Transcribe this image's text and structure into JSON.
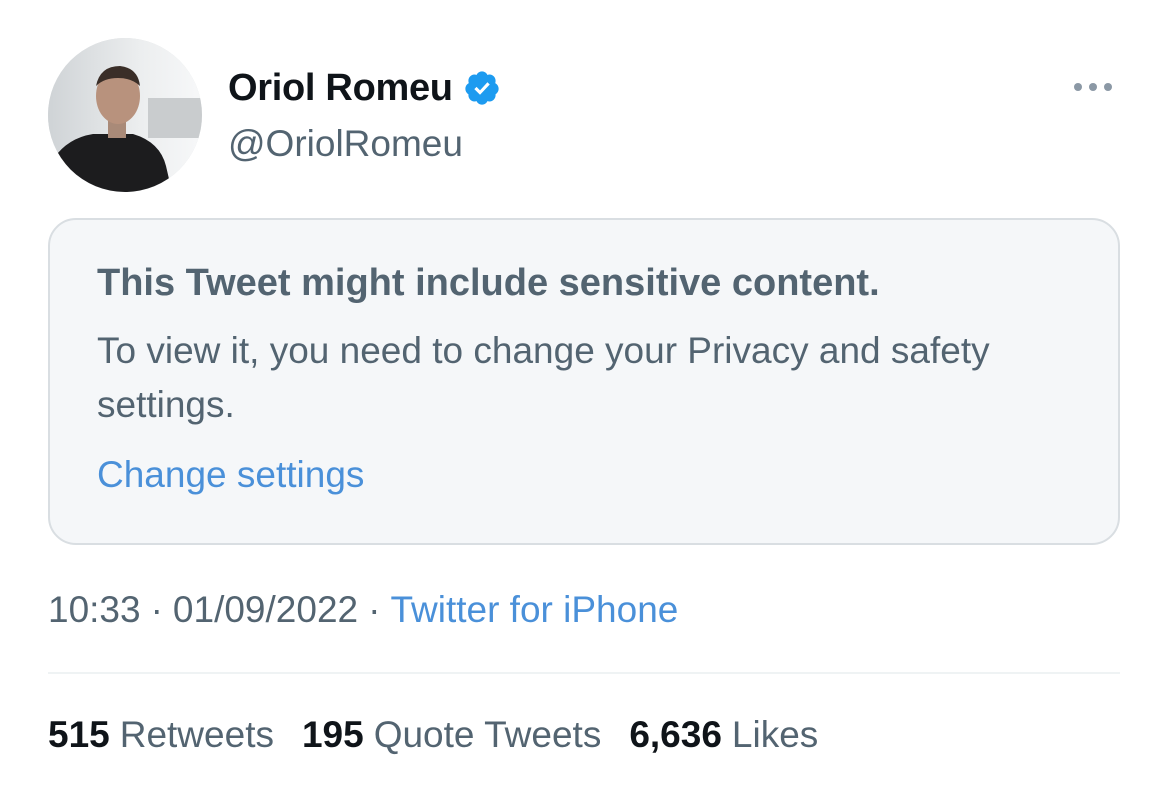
{
  "author": {
    "name": "Oriol Romeu",
    "handle": "@OriolRomeu",
    "verified": true,
    "avatar_icon": "profile-photo",
    "verified_icon": "verified-badge-icon"
  },
  "notice": {
    "title": "This Tweet might include sensitive content.",
    "body": "To view it, you need to change your Privacy and safety settings.",
    "link": "Change settings"
  },
  "meta": {
    "time": "10:33",
    "separator": "·",
    "date": "01/09/2022",
    "source": "Twitter for iPhone"
  },
  "stats": {
    "retweets_count": "515",
    "retweets_label": "Retweets",
    "quotes_count": "195",
    "quotes_label": "Quote Tweets",
    "likes_count": "6,636",
    "likes_label": "Likes"
  },
  "colors": {
    "link": "#4a90d9",
    "secondary_text": "#536471",
    "verified": "#1d9bf0",
    "notice_bg": "#f5f7f9"
  }
}
